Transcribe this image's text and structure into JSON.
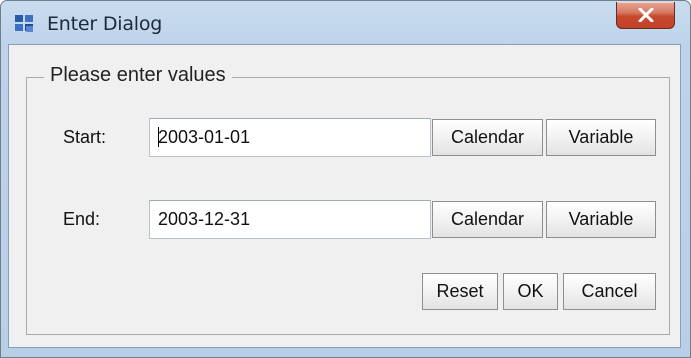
{
  "window": {
    "title": "Enter Dialog",
    "icon": "app-window-icon",
    "close_icon": "close-icon"
  },
  "group": {
    "title": "Please enter values"
  },
  "start": {
    "label": "Start:",
    "value": "2003-01-01",
    "calendar_label": "Calendar",
    "variable_label": "Variable"
  },
  "end": {
    "label": "End:",
    "value": "2003-12-31",
    "calendar_label": "Calendar",
    "variable_label": "Variable"
  },
  "actions": {
    "reset_label": "Reset",
    "ok_label": "OK",
    "cancel_label": "Cancel"
  },
  "colors": {
    "frame": "#bed3ea",
    "close_button": "#c54a2f",
    "client": "#f0f0f0"
  }
}
